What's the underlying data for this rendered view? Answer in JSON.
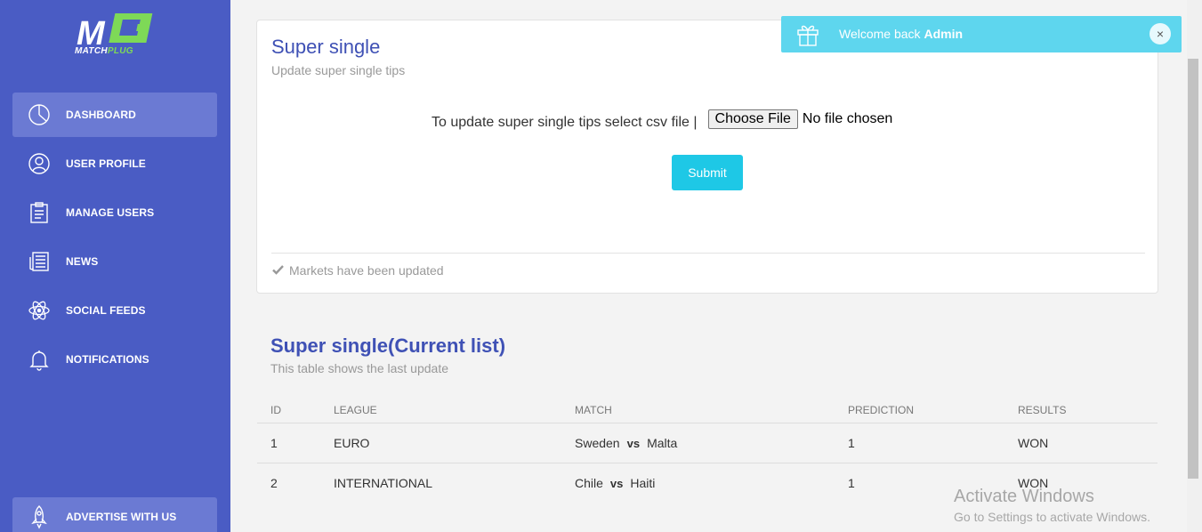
{
  "brand": {
    "logo_mark": "M",
    "logo_text_1": "MATCH",
    "logo_text_2": "PLUG"
  },
  "sidebar": {
    "items": [
      {
        "label": "DASHBOARD",
        "icon": "pie-chart-icon",
        "active": true
      },
      {
        "label": "USER PROFILE",
        "icon": "user-icon"
      },
      {
        "label": "MANAGE USERS",
        "icon": "clipboard-icon"
      },
      {
        "label": "NEWS",
        "icon": "newspaper-icon"
      },
      {
        "label": "SOCIAL FEEDS",
        "icon": "atom-icon"
      },
      {
        "label": "NOTIFICATIONS",
        "icon": "bell-icon"
      }
    ],
    "bottom": {
      "label": "ADVERTISE WITH US",
      "icon": "rocket-icon"
    }
  },
  "upload_card": {
    "title": "Super single",
    "subtitle": "Update super single tips",
    "prompt": "To update super single tips select csv file |",
    "choose_file_label": "Choose File",
    "file_status": "No file chosen",
    "submit_label": "Submit",
    "footer": "Markets have been updated"
  },
  "current_list": {
    "title": "Super single(Current list)",
    "subtitle": "This table shows the last update",
    "columns": [
      "ID",
      "LEAGUE",
      "MATCH",
      "PREDICTION",
      "RESULTS"
    ],
    "rows": [
      {
        "id": "1",
        "league": "EURO",
        "home": "Sweden",
        "vs": "vs",
        "away": "Malta",
        "prediction": "1",
        "result": "WON"
      },
      {
        "id": "2",
        "league": "INTERNATIONAL",
        "home": "Chile",
        "vs": "vs",
        "away": "Haiti",
        "prediction": "1",
        "result": "WON"
      }
    ]
  },
  "toast": {
    "prefix": "Welcome back ",
    "user": "Admin",
    "close": "×"
  },
  "watermark": {
    "line1": "Activate Windows",
    "line2": "Go to Settings to activate Windows."
  },
  "colors": {
    "sidebar": "#4a5cc4",
    "accent": "#3f51b5",
    "button": "#1ec8e6",
    "toast": "#5ed6ee",
    "logo_green": "#7ed957"
  }
}
